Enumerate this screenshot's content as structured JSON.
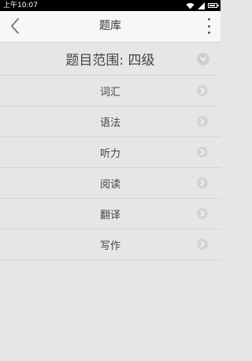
{
  "status_bar": {
    "time": "上午10:07"
  },
  "header": {
    "title": "题库"
  },
  "scope": {
    "label": "题目范围: 四级"
  },
  "items": [
    {
      "label": "词汇"
    },
    {
      "label": "语法"
    },
    {
      "label": "听力"
    },
    {
      "label": "阅读"
    },
    {
      "label": "翻译"
    },
    {
      "label": "写作"
    }
  ],
  "icons": {
    "back": "chevron-left-icon",
    "more": "more-vertical-icon",
    "scope_toggle": "chevron-down-circle-icon",
    "row_arrow": "chevron-right-circle-icon"
  }
}
